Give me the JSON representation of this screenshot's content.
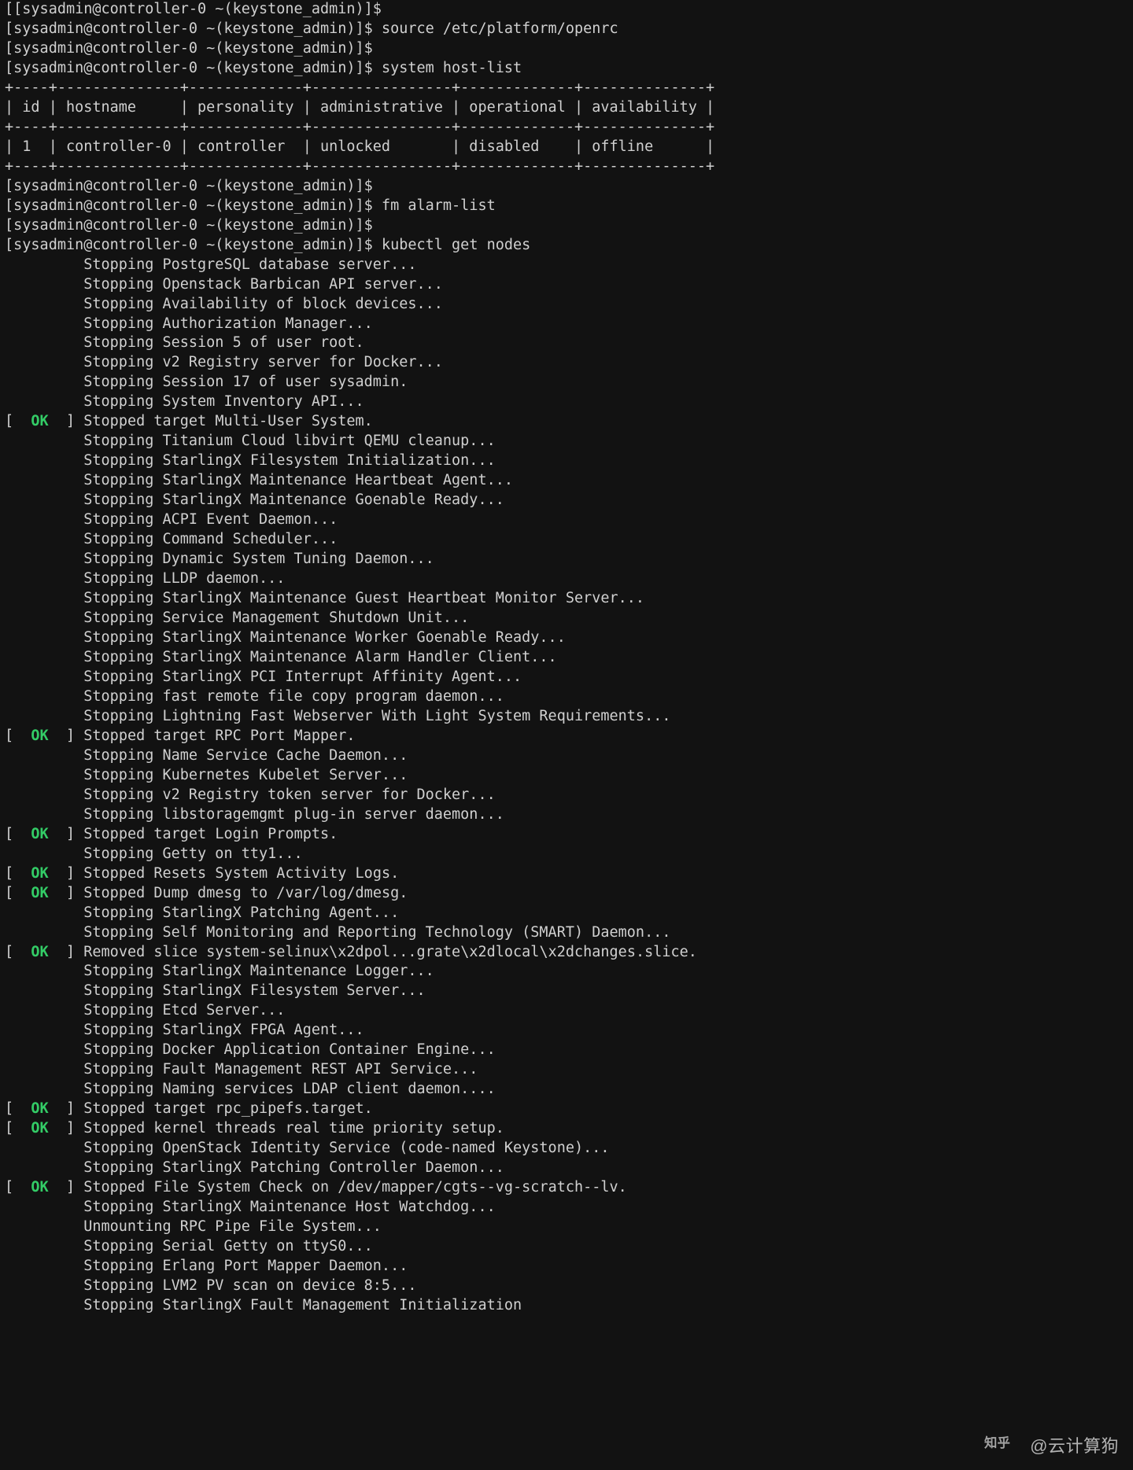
{
  "prompt": "[sysadmin@controller-0 ~(keystone_admin)]$",
  "prompt_first": "[[sysadmin@controller-0 ~(keystone_admin)]$",
  "commands": {
    "source_openrc": "source /etc/platform/openrc",
    "host_list": "system host-list",
    "alarm_list": "fm alarm-list",
    "kubectl_nodes": "kubectl get nodes"
  },
  "host_table": {
    "border": "+----+--------------+-------------+----------------+-------------+--------------+",
    "header": "| id | hostname     | personality | administrative | operational | availability |",
    "row": "| 1  | controller-0 | controller  | unlocked       | disabled    | offline      |"
  },
  "chart_data": {
    "type": "table",
    "title": "system host-list",
    "columns": [
      "id",
      "hostname",
      "personality",
      "administrative",
      "operational",
      "availability"
    ],
    "rows": [
      [
        "1",
        "controller-0",
        "controller",
        "unlocked",
        "disabled",
        "offline"
      ]
    ]
  },
  "log": [
    {
      "status": null,
      "text": "         Stopping PostgreSQL database server..."
    },
    {
      "status": null,
      "text": "         Stopping Openstack Barbican API server..."
    },
    {
      "status": null,
      "text": "         Stopping Availability of block devices..."
    },
    {
      "status": null,
      "text": "         Stopping Authorization Manager..."
    },
    {
      "status": null,
      "text": "         Stopping Session 5 of user root."
    },
    {
      "status": null,
      "text": "         Stopping v2 Registry server for Docker..."
    },
    {
      "status": null,
      "text": "         Stopping Session 17 of user sysadmin."
    },
    {
      "status": null,
      "text": "         Stopping System Inventory API..."
    },
    {
      "status": "OK",
      "text": "Stopped target Multi-User System."
    },
    {
      "status": null,
      "text": "         Stopping Titanium Cloud libvirt QEMU cleanup..."
    },
    {
      "status": null,
      "text": "         Stopping StarlingX Filesystem Initialization..."
    },
    {
      "status": null,
      "text": "         Stopping StarlingX Maintenance Heartbeat Agent..."
    },
    {
      "status": null,
      "text": "         Stopping StarlingX Maintenance Goenable Ready..."
    },
    {
      "status": null,
      "text": "         Stopping ACPI Event Daemon..."
    },
    {
      "status": null,
      "text": "         Stopping Command Scheduler..."
    },
    {
      "status": null,
      "text": "         Stopping Dynamic System Tuning Daemon..."
    },
    {
      "status": null,
      "text": "         Stopping LLDP daemon..."
    },
    {
      "status": null,
      "text": "         Stopping StarlingX Maintenance Guest Heartbeat Monitor Server..."
    },
    {
      "status": null,
      "text": "         Stopping Service Management Shutdown Unit..."
    },
    {
      "status": null,
      "text": "         Stopping StarlingX Maintenance Worker Goenable Ready..."
    },
    {
      "status": null,
      "text": "         Stopping StarlingX Maintenance Alarm Handler Client..."
    },
    {
      "status": null,
      "text": "         Stopping StarlingX PCI Interrupt Affinity Agent..."
    },
    {
      "status": null,
      "text": "         Stopping fast remote file copy program daemon..."
    },
    {
      "status": null,
      "text": "         Stopping Lightning Fast Webserver With Light System Requirements..."
    },
    {
      "status": "OK",
      "text": "Stopped target RPC Port Mapper."
    },
    {
      "status": null,
      "text": "         Stopping Name Service Cache Daemon..."
    },
    {
      "status": null,
      "text": "         Stopping Kubernetes Kubelet Server..."
    },
    {
      "status": null,
      "text": "         Stopping v2 Registry token server for Docker..."
    },
    {
      "status": null,
      "text": "         Stopping libstoragemgmt plug-in server daemon..."
    },
    {
      "status": "OK",
      "text": "Stopped target Login Prompts."
    },
    {
      "status": null,
      "text": "         Stopping Getty on tty1..."
    },
    {
      "status": "OK",
      "text": "Stopped Resets System Activity Logs."
    },
    {
      "status": "OK",
      "text": "Stopped Dump dmesg to /var/log/dmesg."
    },
    {
      "status": null,
      "text": "         Stopping StarlingX Patching Agent..."
    },
    {
      "status": null,
      "text": "         Stopping Self Monitoring and Reporting Technology (SMART) Daemon..."
    },
    {
      "status": "OK",
      "text": "Removed slice system-selinux\\x2dpol...grate\\x2dlocal\\x2dchanges.slice."
    },
    {
      "status": null,
      "text": "         Stopping StarlingX Maintenance Logger..."
    },
    {
      "status": null,
      "text": "         Stopping StarlingX Filesystem Server..."
    },
    {
      "status": null,
      "text": "         Stopping Etcd Server..."
    },
    {
      "status": null,
      "text": "         Stopping StarlingX FPGA Agent..."
    },
    {
      "status": null,
      "text": "         Stopping Docker Application Container Engine..."
    },
    {
      "status": null,
      "text": "         Stopping Fault Management REST API Service..."
    },
    {
      "status": null,
      "text": "         Stopping Naming services LDAP client daemon...."
    },
    {
      "status": "OK",
      "text": "Stopped target rpc_pipefs.target."
    },
    {
      "status": "OK",
      "text": "Stopped kernel threads real time priority setup."
    },
    {
      "status": null,
      "text": "         Stopping OpenStack Identity Service (code-named Keystone)..."
    },
    {
      "status": null,
      "text": "         Stopping StarlingX Patching Controller Daemon..."
    },
    {
      "status": "OK",
      "text": "Stopped File System Check on /dev/mapper/cgts--vg-scratch--lv."
    },
    {
      "status": null,
      "text": "         Stopping StarlingX Maintenance Host Watchdog..."
    },
    {
      "status": null,
      "text": "         Unmounting RPC Pipe File System..."
    },
    {
      "status": null,
      "text": "         Stopping Serial Getty on ttyS0..."
    },
    {
      "status": null,
      "text": "         Stopping Erlang Port Mapper Daemon..."
    },
    {
      "status": null,
      "text": "         Stopping LVM2 PV scan on device 8:5..."
    },
    {
      "status": null,
      "text": "         Stopping StarlingX Fault Management Initialization"
    }
  ],
  "watermark": {
    "text": "@云计算狗"
  }
}
